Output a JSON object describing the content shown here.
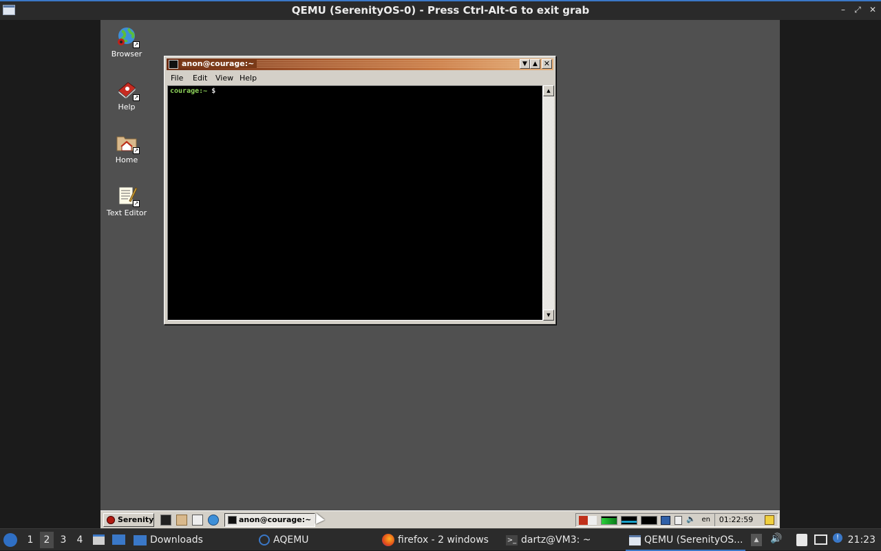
{
  "host_window": {
    "title": "QEMU (SerenityOS-0) - Press Ctrl-Alt-G to exit grab",
    "controls": {
      "minimize": "–",
      "maximize": "⤢",
      "close": "✕"
    }
  },
  "desktop_icons": [
    {
      "label": "Browser",
      "icon": "globe-icon"
    },
    {
      "label": "Help",
      "icon": "help-book-icon"
    },
    {
      "label": "Home",
      "icon": "home-folder-icon"
    },
    {
      "label": "Text Editor",
      "icon": "text-editor-icon"
    }
  ],
  "terminal": {
    "title": "anon@courage:~",
    "menu": [
      "File",
      "Edit",
      "View",
      "Help"
    ],
    "prompt_host": "courage:~",
    "prompt_symbol": "$"
  },
  "guest_taskbar": {
    "start_label": "Serenity",
    "window_button": "anon@courage:~",
    "language": "en",
    "clock": "01:22:59"
  },
  "host_taskbar": {
    "workspaces": [
      "1",
      "2",
      "3",
      "4"
    ],
    "active_workspace": "2",
    "tasks": [
      {
        "label": "Downloads",
        "icon": "folder-icon"
      },
      {
        "label": "AQEMU",
        "icon": "aqemu-icon"
      },
      {
        "label": "firefox - 2 windows",
        "icon": "firefox-icon"
      },
      {
        "label": "dartz@VM3: ~",
        "icon": "terminal-icon"
      },
      {
        "label": "QEMU (SerenityOS...",
        "icon": "qemu-window-icon"
      }
    ],
    "clock": "21:23"
  },
  "colors": {
    "desktop": "#505050",
    "titlebar_start": "#6b2b12",
    "titlebar_end": "#e6b07a",
    "prompt": "#8fd45b",
    "accent": "#3a78c8"
  }
}
